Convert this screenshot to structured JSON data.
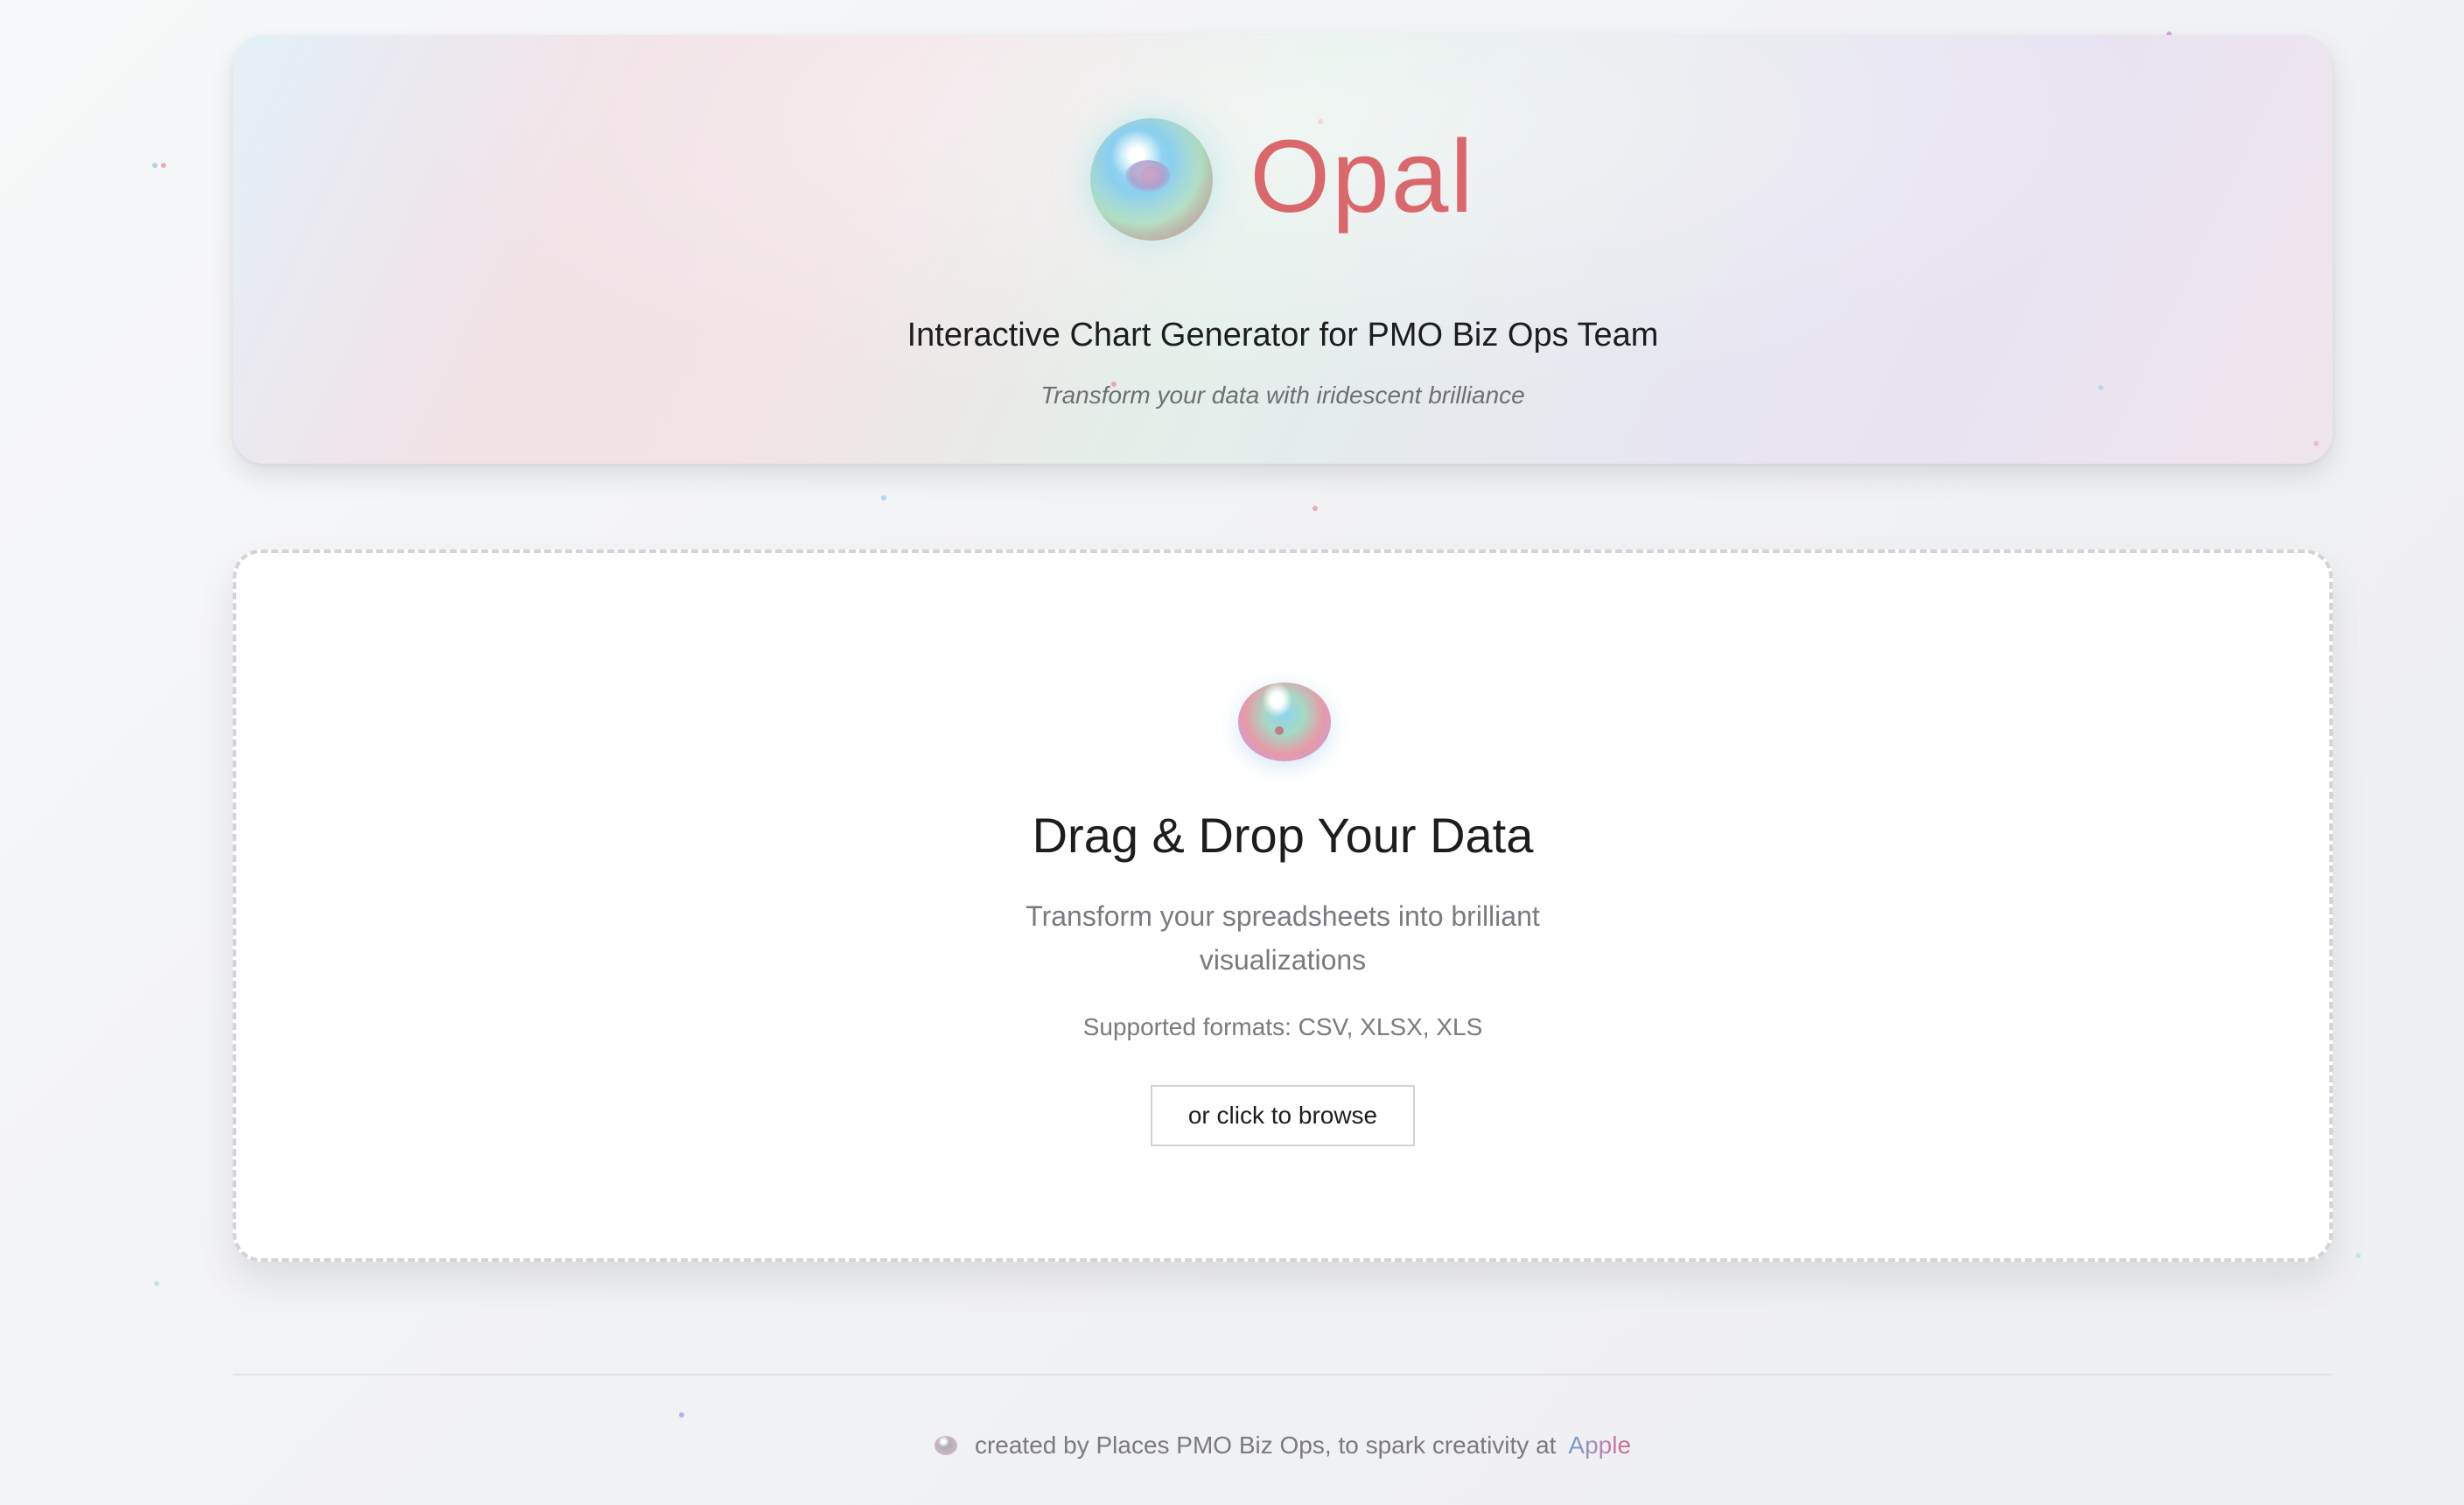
{
  "header": {
    "app_name": "Opal",
    "subtitle": "Interactive Chart Generator for PMO Biz Ops Team",
    "tagline": "Transform your data with iridescent brilliance"
  },
  "upload": {
    "title": "Drag & Drop Your Data",
    "description": "Transform your spreadsheets into brilliant visualizations",
    "formats": "Supported formats: CSV, XLSX, XLS",
    "browse_label": "or click to browse"
  },
  "footer": {
    "text": "created by Places PMO Biz Ops, to spark creativity at",
    "link_label": "Apple"
  },
  "colors": {
    "brand": "#d9676b",
    "text": "#1d1d1f",
    "muted": "#7a7a7f"
  },
  "icons": {
    "logo": "opal-orb-icon",
    "upload": "upload-orb-icon",
    "footer": "opal-small-icon"
  }
}
